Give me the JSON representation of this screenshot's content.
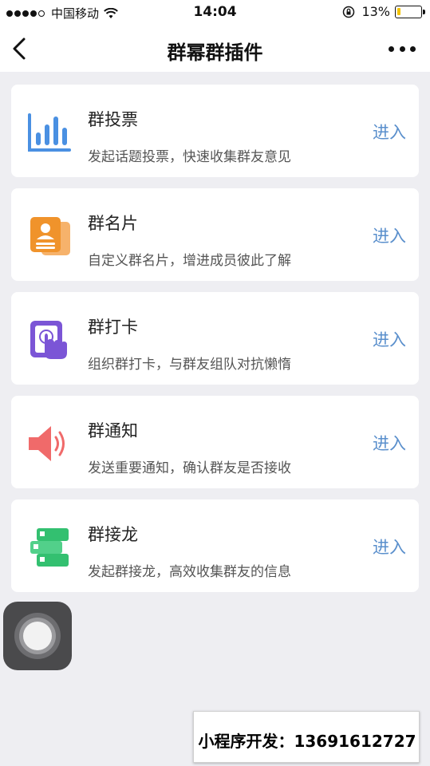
{
  "status_bar": {
    "carrier": "中国移动",
    "time": "14:04",
    "battery_percent": "13%",
    "battery_level": 0.13,
    "battery_color": "#f3c300"
  },
  "nav": {
    "title": "群幂群插件",
    "back_icon": "chevron-left-icon",
    "more_icon": "more-dots-icon"
  },
  "accent_link_color": "#5a8fcc",
  "items": [
    {
      "title": "群投票",
      "desc": "发起话题投票，快速收集群友意见",
      "action": "进入",
      "icon": "bar-chart-icon",
      "icon_color": "#4a90e2"
    },
    {
      "title": "群名片",
      "desc": "自定义群名片，增进成员彼此了解",
      "action": "进入",
      "icon": "contact-card-icon",
      "icon_color": "#f0932b"
    },
    {
      "title": "群打卡",
      "desc": "组织群打卡，与群友组队对抗懒惰",
      "action": "进入",
      "icon": "touch-checkin-icon",
      "icon_color": "#7b55d6"
    },
    {
      "title": "群通知",
      "desc": "发送重要通知，确认群友是否接收",
      "action": "进入",
      "icon": "speaker-icon",
      "icon_color": "#f06a6a"
    },
    {
      "title": "群接龙",
      "desc": "发起群接龙，高效收集群友的信息",
      "action": "进入",
      "icon": "relay-cards-icon",
      "icon_color": "#33c070"
    }
  ],
  "promo": {
    "text": "小程序开发：13691612727"
  }
}
